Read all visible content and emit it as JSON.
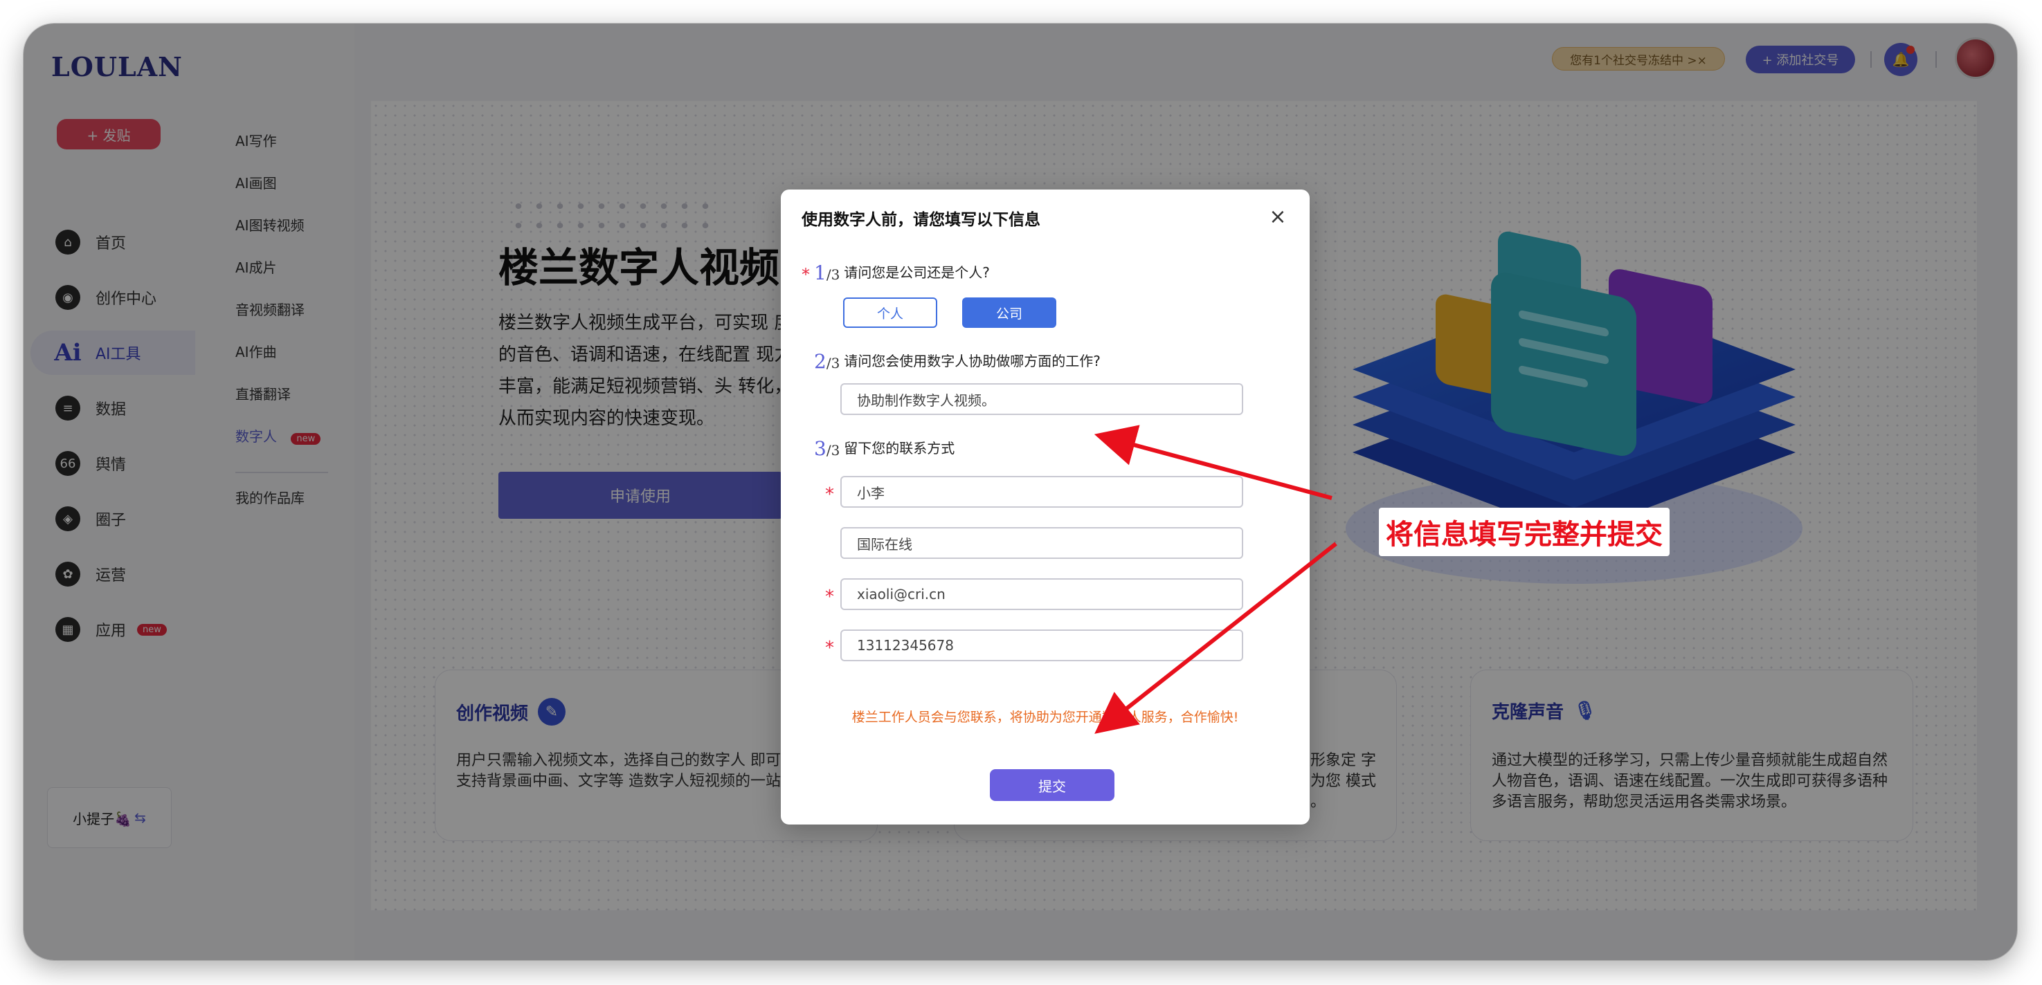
{
  "app": {
    "logo": "LOULAN"
  },
  "sidebar": {
    "post_label": "+ 发贴",
    "items": [
      {
        "label": "首页",
        "icon": "home-icon",
        "glyph": "⌂"
      },
      {
        "label": "创作中心",
        "icon": "palette-icon",
        "glyph": "◉"
      },
      {
        "label": "AI工具",
        "icon": "ai-icon",
        "glyph": "Ai"
      },
      {
        "label": "数据",
        "icon": "database-icon",
        "glyph": "≡"
      },
      {
        "label": "舆情",
        "icon": "sentiment-icon",
        "glyph": "66"
      },
      {
        "label": "圈子",
        "icon": "compass-icon",
        "glyph": "◈"
      },
      {
        "label": "运营",
        "icon": "operation-icon",
        "glyph": "✿"
      },
      {
        "label": "应用",
        "icon": "apps-icon",
        "glyph": "▦",
        "badge": "new"
      }
    ],
    "user": {
      "name": "小提子🍇",
      "switch_glyph": "⇆"
    }
  },
  "subnav": {
    "items": [
      "AI写作",
      "AI画图",
      "AI图转视频",
      "AI成片",
      "音视频翻译",
      "AI作曲",
      "直播翻译",
      "数字人"
    ],
    "badge": "new",
    "library": "我的作品库"
  },
  "topbar": {
    "notice": "您有1个社交号冻结中 >×",
    "add_account": "+ 添加社交号",
    "bell_glyph": "🔔"
  },
  "hero": {
    "title": "楼兰数字人视频",
    "description": "楼兰数字人视频生成平台，可实现 度的音色、语调和语速，在线配置 现力丰富，能满足短视频营销、头 转化，从而实现内容的快速变现。",
    "apply_label": "申请使用"
  },
  "features": [
    {
      "title": "创作视频",
      "icon": "feather-badge-icon",
      "glyph": "✎",
      "text": "用户只需输入视频文本，选择自己的数字人 即可。平台同时支持背景画中画、文字等 造数字人短视频的一站式生成。"
    },
    {
      "title": "",
      "icon": "",
      "glyph": "",
      "text": "个人形象定 字人，为您 模式助力。"
    },
    {
      "title": "克隆声音",
      "icon": "microphone-icon",
      "glyph": "🎙",
      "text": "通过大模型的迁移学习，只需上传少量音频就能生成超自然人物音色，语调、语速在线配置。一次生成即可获得多语种多语言服务，帮助您灵活运用各类需求场景。"
    }
  ],
  "modal": {
    "title": "使用数字人前，请您填写以下信息",
    "close_glyph": "×",
    "q1": {
      "num": "1",
      "denom": "/3",
      "text": "请问您是公司还是个人?",
      "options": [
        "个人",
        "公司"
      ],
      "selected": "公司"
    },
    "q2": {
      "num": "2",
      "denom": "/3",
      "text": "请问您会使用数字人协助做哪方面的工作?",
      "placeholder": "协助制作数字人视频。"
    },
    "q3": {
      "num": "3",
      "denom": "/3",
      "text": "留下您的联系方式"
    },
    "fields": [
      {
        "value": "小李",
        "required": true
      },
      {
        "value": "国际在线",
        "required": false
      },
      {
        "value": "xiaoli@cri.cn",
        "required": true
      },
      {
        "value": "13112345678",
        "required": true
      }
    ],
    "notice": "楼兰工作人员会与您联系，将协助为您开通数字人服务，合作愉快!",
    "submit_label": "提交"
  },
  "annotation": {
    "text": "将信息填写完整并提交",
    "color": "#e8101c"
  },
  "colors": {
    "accent": "#5a5fd6",
    "brand_red": "#e8283f",
    "notice_orange": "#e86a22"
  }
}
